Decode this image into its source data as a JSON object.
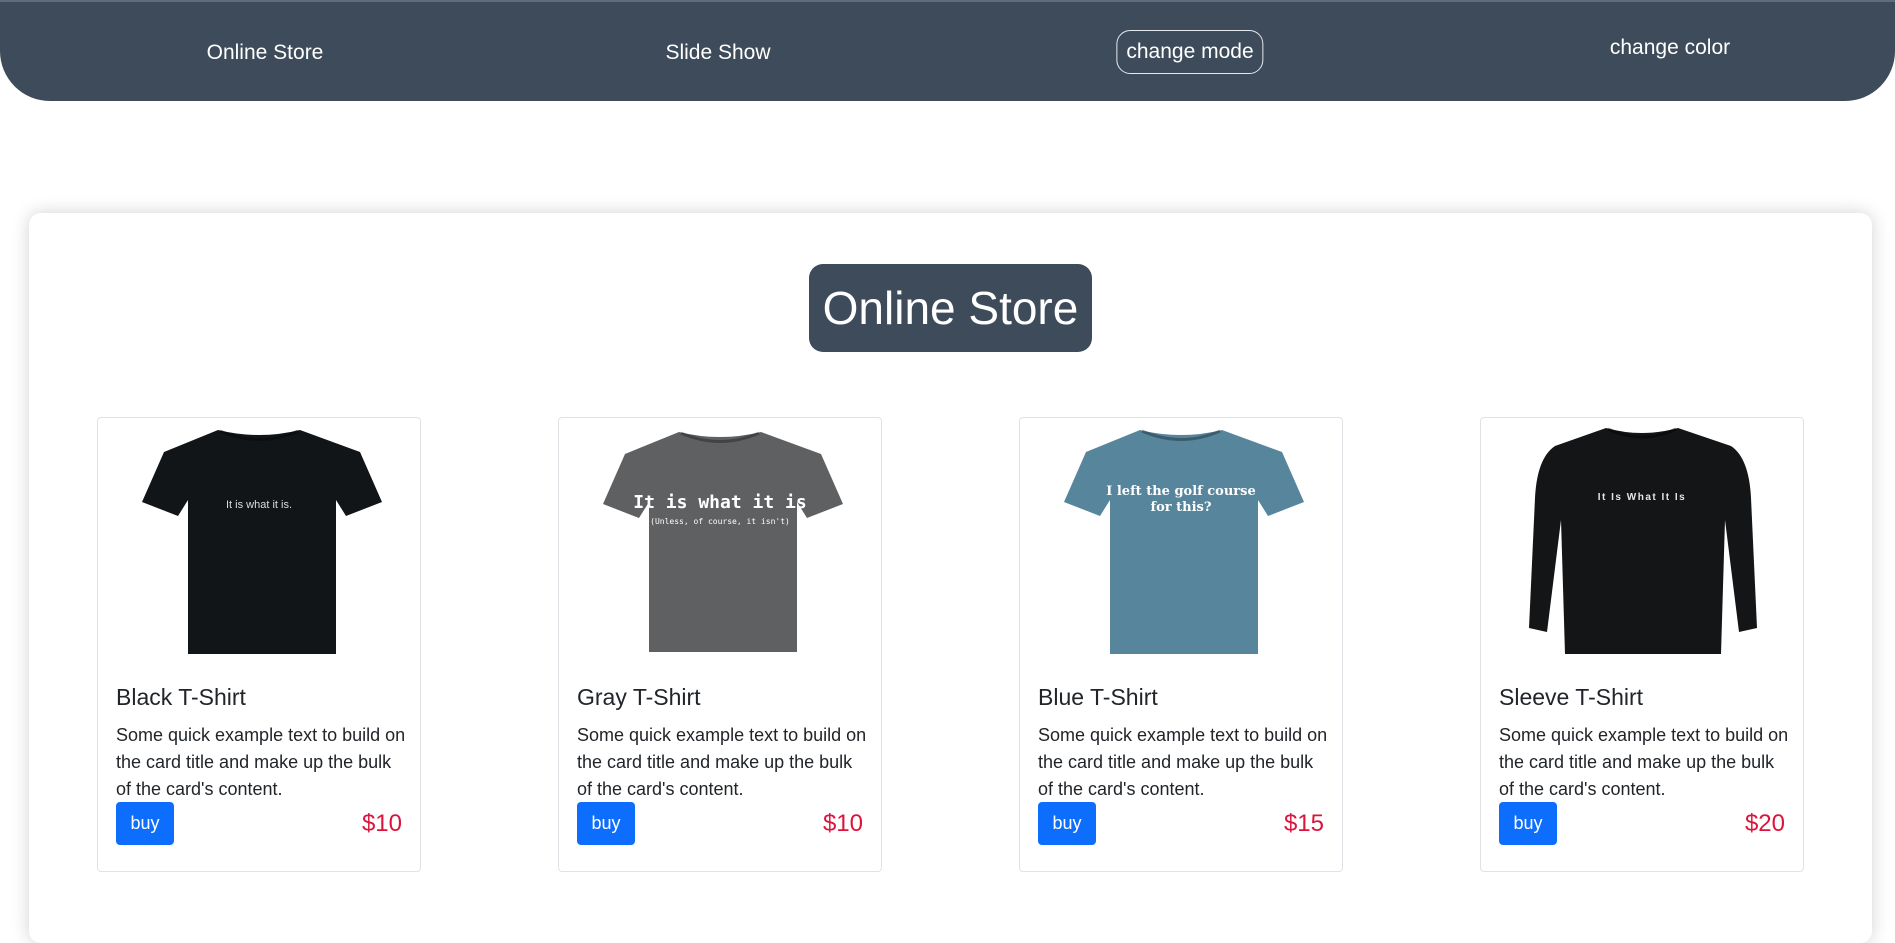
{
  "nav": {
    "online_store": "Online Store",
    "slide_show": "Slide Show",
    "change_mode": "change mode",
    "change_color": "change color"
  },
  "main": {
    "heading": "Online Store"
  },
  "colors": {
    "navbar": "#3d4b5a",
    "buy_button": "#0d6efd",
    "price": "#dc143c"
  },
  "cards": [
    {
      "title": "Black T-Shirt",
      "text": "Some quick example text to build on the card title and make up the bulk of the card's content.",
      "button": "buy",
      "price": "$10",
      "shirt_color": "#111518",
      "shirt_print": "It is what it is.",
      "sleeve": "short"
    },
    {
      "title": "Gray T-Shirt",
      "text": "Some quick example text to build on the card title and make up the bulk of the card's content.",
      "button": "buy",
      "price": "$10",
      "shirt_color": "#5f6062",
      "shirt_print": "It is what it is",
      "shirt_print_sub": "(Unless, of course, it isn't)",
      "sleeve": "short"
    },
    {
      "title": "Blue T-Shirt",
      "text": "Some quick example text to build on the card title and make up the bulk of the card's content.",
      "button": "buy",
      "price": "$15",
      "shirt_color": "#56859c",
      "shirt_print": "I left the golf course",
      "shirt_print_sub": "for this?",
      "sleeve": "short"
    },
    {
      "title": "Sleeve T-Shirt",
      "text": "Some quick example text to build on the card title and make up the bulk of the card's content.",
      "button": "buy",
      "price": "$20",
      "shirt_color": "#141516",
      "shirt_print": "It Is What It Is",
      "sleeve": "long"
    }
  ]
}
